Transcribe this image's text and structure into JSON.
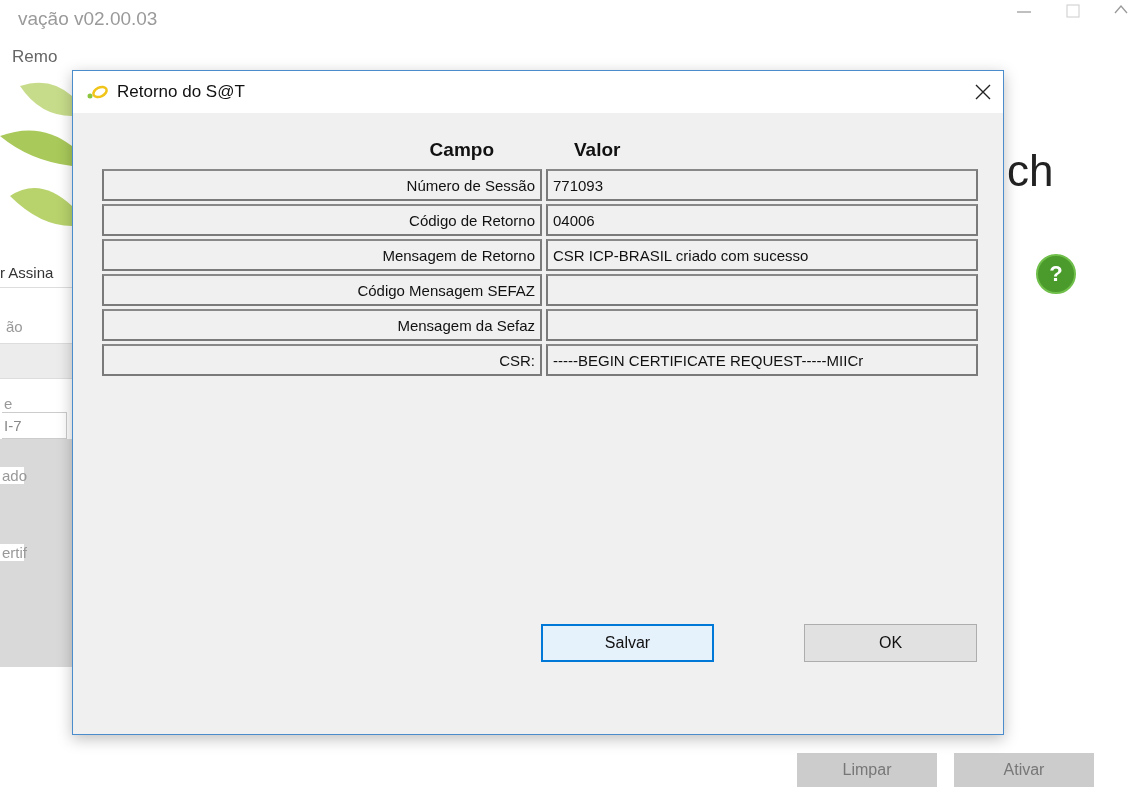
{
  "background_window": {
    "title": "vação v02.00.03",
    "menu": [
      "Remo"
    ],
    "tab": "r Assina",
    "logo_text": "ch",
    "help_button": "?",
    "left_fragments": [
      {
        "kind": "label",
        "text": "ão"
      },
      {
        "kind": "bar"
      },
      {
        "kind": "label",
        "text": "e"
      },
      {
        "kind": "field",
        "text": "I-7"
      },
      {
        "kind": "panel_label",
        "text": "ado"
      },
      {
        "kind": "panel_label",
        "text": "ertif"
      }
    ],
    "buttons": [
      "Limpar",
      "Ativar"
    ]
  },
  "dialog": {
    "title": "Retorno do S@T",
    "columns": [
      "Campo",
      "Valor"
    ],
    "rows": [
      {
        "field": "Número de Sessão",
        "value": "771093"
      },
      {
        "field": "Código de Retorno",
        "value": "04006"
      },
      {
        "field": "Mensagem de Retorno",
        "value": "CSR ICP-BRASIL criado com sucesso"
      },
      {
        "field": "Código Mensagem SEFAZ"
      },
      {
        "field": "Mensagem da Sefaz"
      },
      {
        "field": "CSR:",
        "value": "-----BEGIN CERTIFICATE REQUEST-----MIICr"
      }
    ],
    "buttons": [
      {
        "label": "Salvar",
        "focused": true
      },
      {
        "label": "OK",
        "focused": false
      }
    ]
  }
}
